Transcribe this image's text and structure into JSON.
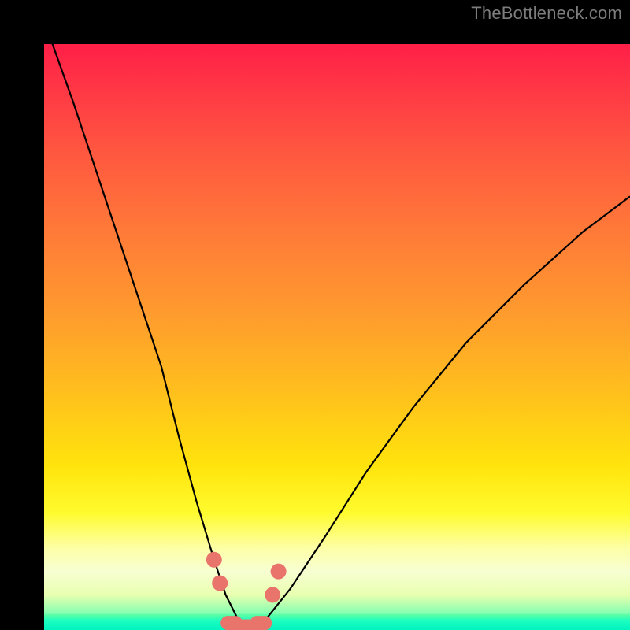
{
  "watermark": "TheBottleneck.com",
  "colors": {
    "frame": "#000000",
    "gradient_top": "#ff1f47",
    "gradient_mid": "#ffe40c",
    "gradient_bottom": "#00f5c3",
    "curve": "#000000",
    "marker": "#e9746c"
  },
  "chart_data": {
    "type": "line",
    "title": "",
    "xlabel": "",
    "ylabel": "",
    "xlim": [
      0,
      100
    ],
    "ylim": [
      0,
      100
    ],
    "grid": false,
    "legend": false,
    "annotations": [
      "TheBottleneck.com"
    ],
    "series": [
      {
        "name": "bottleneck-curve",
        "x": [
          0,
          5,
          10,
          15,
          20,
          23,
          26,
          29,
          31,
          33,
          35,
          38,
          42,
          48,
          55,
          63,
          72,
          82,
          92,
          100
        ],
        "y": [
          104,
          90,
          75,
          60,
          45,
          33,
          22,
          12,
          6,
          2,
          0.5,
          2,
          7,
          16,
          27,
          38,
          49,
          59,
          68,
          74
        ]
      }
    ],
    "markers": [
      {
        "name": "left-upper-dot",
        "x": 29,
        "y": 12
      },
      {
        "name": "left-lower-dot",
        "x": 30,
        "y": 8
      },
      {
        "name": "right-upper-dot",
        "x": 40,
        "y": 10
      },
      {
        "name": "right-lower-dot",
        "x": 39,
        "y": 6
      },
      {
        "name": "valley-seg-1",
        "x": 32,
        "y": 1.2
      },
      {
        "name": "valley-seg-2",
        "x": 34.5,
        "y": 0.6
      },
      {
        "name": "valley-seg-3",
        "x": 37,
        "y": 1.2
      }
    ],
    "background_gradient_stops": [
      {
        "pos": 0,
        "color": "#ff1f47"
      },
      {
        "pos": 46,
        "color": "#ff9b2e"
      },
      {
        "pos": 80,
        "color": "#fffb2e"
      },
      {
        "pos": 97,
        "color": "#8affb0"
      },
      {
        "pos": 100,
        "color": "#00f5c3"
      }
    ]
  }
}
